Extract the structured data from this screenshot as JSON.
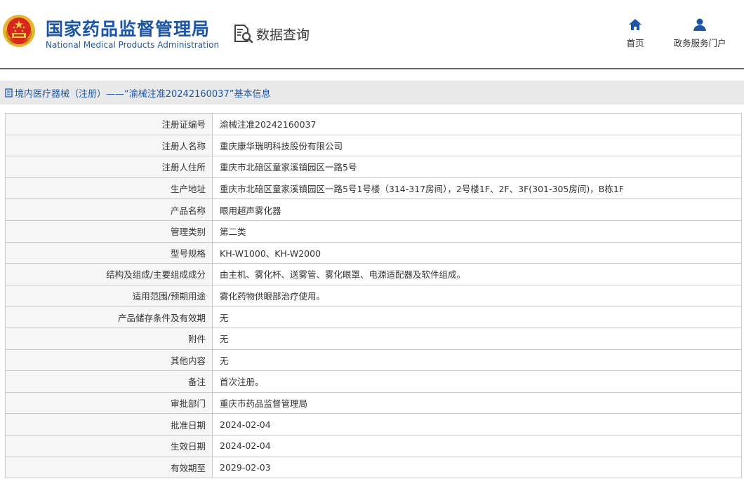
{
  "header": {
    "site_name_cn": "国家药品监督管理局",
    "site_name_en": "National Medical Products Administration",
    "data_query_label": "数据查询",
    "nav": [
      {
        "label": "首页",
        "icon": "home-icon"
      },
      {
        "label": "政务服务门户",
        "icon": "user-icon"
      }
    ]
  },
  "breadcrumb": {
    "text": "境内医疗器械（注册）——“渝械注准20242160037”基本信息",
    "icon": "document-icon"
  },
  "details": [
    {
      "label": "注册证编号",
      "value": "渝械注准20242160037"
    },
    {
      "label": "注册人名称",
      "value": "重庆康华瑞明科技股份有限公司"
    },
    {
      "label": "注册人住所",
      "value": "重庆市北碚区童家溪镇园区一路5号"
    },
    {
      "label": "生产地址",
      "value": "重庆市北碚区童家溪镇园区一路5号1号楼（314-317房间），2号楼1F、2F、3F(301-305房间)，B栋1F"
    },
    {
      "label": "产品名称",
      "value": "眼用超声雾化器"
    },
    {
      "label": "管理类别",
      "value": "第二类"
    },
    {
      "label": "型号规格",
      "value": "KH-W1000、KH-W2000"
    },
    {
      "label": "结构及组成/主要组成成分",
      "value": "由主机、雾化杯、送雾管、雾化眼罩、电源适配器及软件组成。"
    },
    {
      "label": "适用范围/预期用途",
      "value": "雾化药物供眼部治疗使用。"
    },
    {
      "label": "产品储存条件及有效期",
      "value": "无"
    },
    {
      "label": "附件",
      "value": "无"
    },
    {
      "label": "其他内容",
      "value": "无"
    },
    {
      "label": "备注",
      "value": "首次注册。"
    },
    {
      "label": "审批部门",
      "value": "重庆市药品监督管理局"
    },
    {
      "label": "批准日期",
      "value": "2024-02-04"
    },
    {
      "label": "生效日期",
      "value": "2024-02-04"
    },
    {
      "label": "有效期至",
      "value": "2029-02-03"
    }
  ]
}
